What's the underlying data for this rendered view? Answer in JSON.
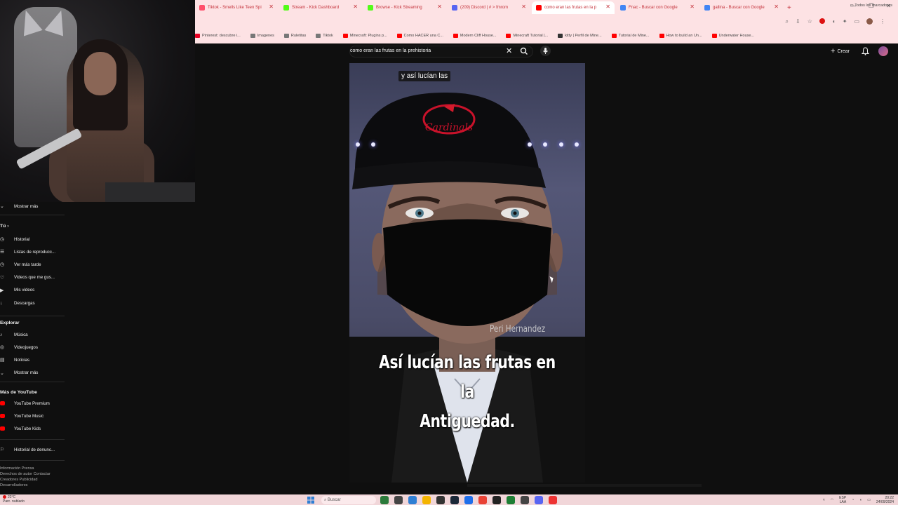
{
  "browser": {
    "tabs": [
      {
        "label": "Tiktok - Smells Like Teen Spi",
        "color": "#ff4f6b"
      },
      {
        "label": "Stream - Kick Dashboard",
        "color": "#53fc18"
      },
      {
        "label": "Browse - Kick Streaming",
        "color": "#53fc18"
      },
      {
        "label": "(209) Discord | # > fmrom",
        "color": "#5865f2"
      },
      {
        "label": "como eran las frutas en la p",
        "color": "#ff0000",
        "active": true
      },
      {
        "label": "Fnac - Buscar con Google",
        "color": "#4285f4"
      },
      {
        "label": "gallina - Buscar con Google",
        "color": "#4285f4"
      }
    ],
    "new_tab": "+",
    "bookmarks": [
      {
        "label": "Pinterest: descubre i...",
        "color": "#e60023"
      },
      {
        "label": "Imagenes",
        "color": "#777777"
      },
      {
        "label": "Ruletitas",
        "color": "#777777"
      },
      {
        "label": "Tiktok",
        "color": "#777777"
      },
      {
        "label": "Minecraft: Plugins p...",
        "color": "#ff0000"
      },
      {
        "label": "Como HACER una C...",
        "color": "#ff0000"
      },
      {
        "label": "Modern Cliff House...",
        "color": "#ff0000"
      },
      {
        "label": "Minecraft Tutorial |...",
        "color": "#ff0000"
      },
      {
        "label": "kitty | Perfil de Mine...",
        "color": "#333333"
      },
      {
        "label": "Tutorial de Mine...",
        "color": "#ff0000"
      },
      {
        "label": "How to build an Un...",
        "color": "#ff0000"
      },
      {
        "label": "Underwater House...",
        "color": "#ff0000"
      }
    ],
    "bookmarks_all": "Todos los marcadores"
  },
  "youtube": {
    "search_query": "como eran las frutas en la prehistoria",
    "create_label": "Crear",
    "sidebar": {
      "mostrar_mas_1": "Mostrar más",
      "you_heading": "Tú",
      "you_items": [
        {
          "icon": "history-icon",
          "glyph": "◷",
          "label": "Historial"
        },
        {
          "icon": "playlist-icon",
          "glyph": "☰",
          "label": "Listas de reproducc..."
        },
        {
          "icon": "watch-later-icon",
          "glyph": "◷",
          "label": "Ver más tarde"
        },
        {
          "icon": "liked-icon",
          "glyph": "♡",
          "label": "Videos que me gus..."
        },
        {
          "icon": "my-videos-icon",
          "glyph": "▶",
          "label": "Mis videos"
        },
        {
          "icon": "downloads-icon",
          "glyph": "↓",
          "label": "Descargas"
        }
      ],
      "explore_heading": "Explorar",
      "explore_items": [
        {
          "icon": "music-icon",
          "glyph": "♪",
          "label": "Música"
        },
        {
          "icon": "gaming-icon",
          "glyph": "◎",
          "label": "Videojuegos"
        },
        {
          "icon": "news-icon",
          "glyph": "▤",
          "label": "Noticias"
        },
        {
          "icon": "chevron-down-icon",
          "glyph": "⌄",
          "label": "Mostrar más"
        }
      ],
      "more_heading": "Más de YouTube",
      "more_items": [
        {
          "label": "YouTube Premium"
        },
        {
          "label": "YouTube Music"
        },
        {
          "label": "YouTube Kids"
        }
      ],
      "report_history": "Historial de denunc...",
      "footer_lines": [
        "Información  Prensa",
        "Derechos de autor  Contactar",
        "Creadores  Publicidad",
        "Desarrolladores"
      ]
    },
    "video": {
      "caption_top": "y así lucían las",
      "caption_main_line1": "Así lucían las frutas en la",
      "caption_main_line2": "Antiguedad.",
      "credit": "Peri Hernandez"
    }
  },
  "taskbar": {
    "weather_temp": "22°C",
    "weather_desc": "Parc. nublado",
    "search_label": "Buscar",
    "lang": "ESP",
    "lang2": "LAA",
    "time": "20:22",
    "date": "24/09/2024",
    "apps": [
      "#2b7a3a",
      "#444444",
      "#2f7fd4",
      "#f4b400",
      "#333333",
      "#1b2838",
      "#1f6feb",
      "#e94235",
      "#222222",
      "#1e7e34",
      "#444444",
      "#5865f2",
      "#e33"
    ]
  }
}
